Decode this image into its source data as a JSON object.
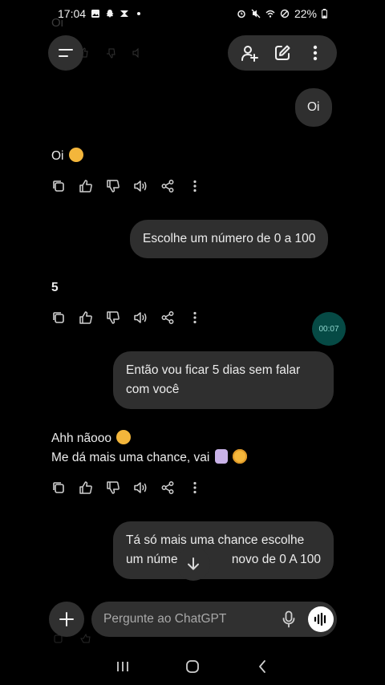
{
  "status_bar": {
    "time": "17:04",
    "battery": "22%",
    "left_icons": [
      "gallery-icon",
      "snapchat-icon",
      "app-icon",
      "dot-icon"
    ],
    "right_icons": [
      "alarm-icon",
      "mute-icon",
      "wifi-icon",
      "dnd-icon",
      "battery-icon"
    ]
  },
  "faded_top_text": "Oi",
  "header": {
    "menu_icon": "menu-icon",
    "add_person_icon": "add-person-icon",
    "new_chat_icon": "edit-icon",
    "more_icon": "more-vertical-icon"
  },
  "messages": [
    {
      "role": "user",
      "text": "Oi"
    },
    {
      "role": "assistant",
      "text": "Oi"
    },
    {
      "role": "user",
      "text": "Escolhe um número de 0 a 100"
    },
    {
      "role": "assistant",
      "text": "5"
    },
    {
      "role": "user",
      "text": "Então vou ficar 5 dias sem falar com você"
    },
    {
      "role": "assistant",
      "line1": "Ahh nãooo",
      "line2": "Me dá mais uma chance, vai"
    },
    {
      "role": "user",
      "text_left": "Tá só mais uma chance escolhe",
      "text_line2a": "um núme",
      "text_line2b": "novo de 0 A 100"
    }
  ],
  "message_actions": [
    "copy-icon",
    "thumbs-up-icon",
    "thumbs-down-icon",
    "read-aloud-icon",
    "share-icon",
    "more-icon"
  ],
  "timer": "00:07",
  "composer": {
    "placeholder": "Pergunte ao ChatGPT"
  },
  "colors": {
    "background": "#000000",
    "bubble": "#2f2f2f",
    "pill": "#303030",
    "timer": "#064a45",
    "text": "#ececec"
  }
}
